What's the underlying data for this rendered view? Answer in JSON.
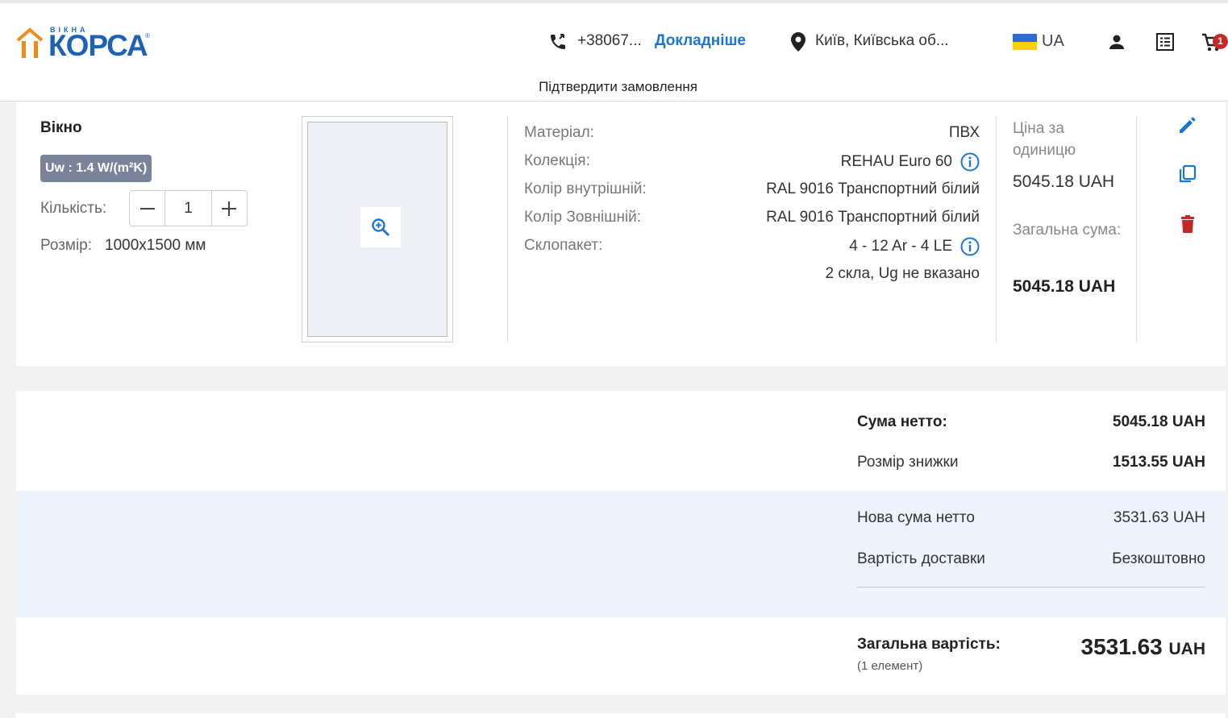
{
  "header": {
    "logo_top": "ВІКНА",
    "logo_main": "КОРСА",
    "logo_reg": "®",
    "phone": "+38067...",
    "phone_more": "Докладніше",
    "location": "Київ, Київська об...",
    "language": "UA",
    "cart_count": "1"
  },
  "confirm_bar": {
    "label": "Підтвердити замовлення"
  },
  "item": {
    "title": "Вікно",
    "uw_badge": "Uw : 1.4 W/(m²K)",
    "quantity_label": "Кількість:",
    "quantity": "1",
    "size_label": "Розмір:",
    "size_value": "1000x1500 мм",
    "specs": [
      {
        "key": "Матеріал:",
        "value": "ПВХ"
      },
      {
        "key": "Колекція:",
        "value": "REHAU Euro 60"
      },
      {
        "key": "Колір внутрішній:",
        "value": "RAL 9016 Транспортний білий"
      },
      {
        "key": "Колір Зовнішній:",
        "value": "RAL 9016 Транспортний білий"
      },
      {
        "key": "Склопакет:",
        "value": "4 - 12 Ar - 4 LE"
      }
    ],
    "glass_note": "2 скла, Ug не вказано",
    "unit_price_label": "Ціна за одиницю",
    "unit_price": "5045.18 UAH",
    "total_label": "Загальна сума:",
    "total_price": "5045.18 UAH"
  },
  "summary": {
    "net_label": "Сума нетто:",
    "net_value": "5045.18 UAH",
    "discount_label": "Розмір знижки",
    "discount_value": "1513.55 UAH",
    "new_net_label": "Нова сума нетто",
    "new_net_value": "3531.63 UAH",
    "delivery_label": "Вартість доставки",
    "delivery_value": "Безкоштовно",
    "grand_label": "Загальна вартість:",
    "grand_sub": "(1 елемент)",
    "grand_value": "3531.63",
    "grand_currency": "UAH"
  },
  "colors": {
    "accent_blue": "#1976d2",
    "delete_red": "#c62828",
    "badge_gray": "#7a8399",
    "band_blue": "#edf3fb"
  }
}
